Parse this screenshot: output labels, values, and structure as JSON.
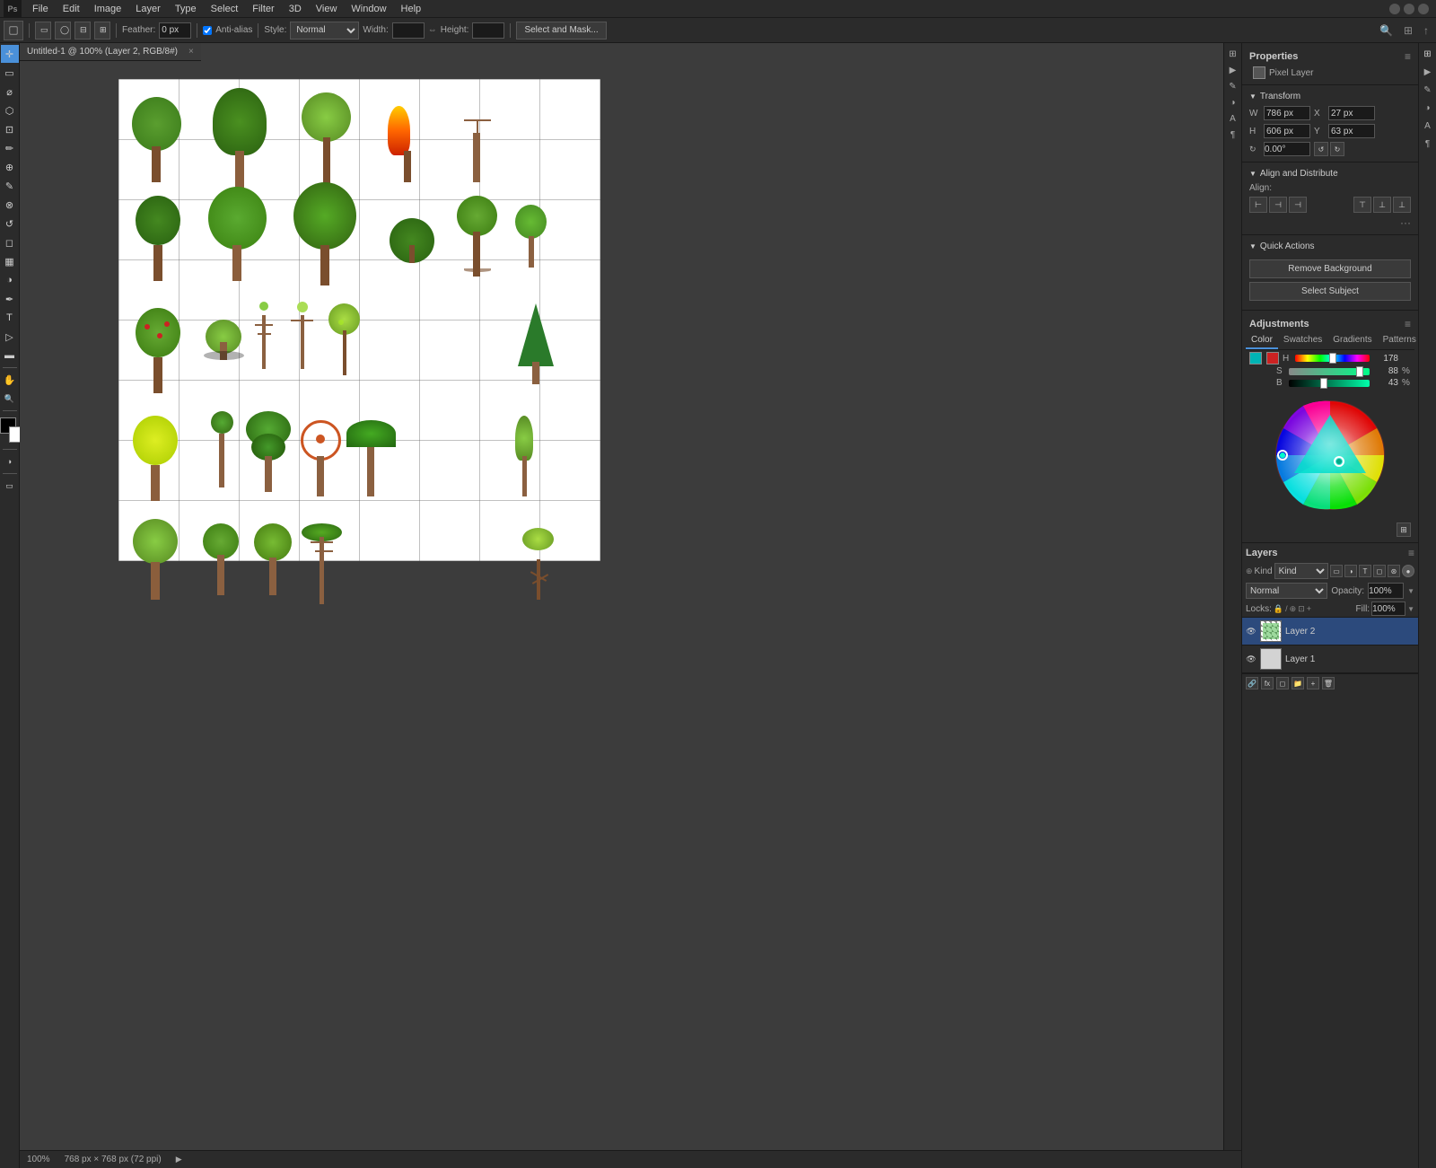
{
  "menubar": {
    "app_icon": "PS",
    "items": [
      "File",
      "Edit",
      "Image",
      "Layer",
      "Type",
      "Select",
      "Filter",
      "3D",
      "View",
      "Window",
      "Help"
    ]
  },
  "toolbar": {
    "feather_label": "Feather:",
    "feather_value": "0 px",
    "anti_alias_label": "Anti-alias",
    "style_label": "Style:",
    "style_value": "Normal",
    "width_label": "Width:",
    "width_value": "",
    "height_label": "Height:",
    "height_value": "",
    "select_mask_btn": "Select and Mask..."
  },
  "canvas_tab": {
    "title": "Untitled-1 @ 100% (Layer 2, RGB/8#)",
    "close": "×"
  },
  "left_tools": [
    {
      "name": "move-tool",
      "icon": "✛",
      "active": true
    },
    {
      "name": "marquee-tool",
      "icon": "▭"
    },
    {
      "name": "lasso-tool",
      "icon": "⌀"
    },
    {
      "name": "quick-select-tool",
      "icon": "⬡"
    },
    {
      "name": "crop-tool",
      "icon": "⊡"
    },
    {
      "name": "eyedropper-tool",
      "icon": "✏"
    },
    {
      "name": "healing-tool",
      "icon": "⊕"
    },
    {
      "name": "brush-tool",
      "icon": "✎"
    },
    {
      "name": "clone-tool",
      "icon": "⊗"
    },
    {
      "name": "history-tool",
      "icon": "↺"
    },
    {
      "name": "eraser-tool",
      "icon": "◻"
    },
    {
      "name": "gradient-tool",
      "icon": "▦"
    },
    {
      "name": "dodge-tool",
      "icon": "◑"
    },
    {
      "name": "pen-tool",
      "icon": "✒"
    },
    {
      "name": "text-tool",
      "icon": "T"
    },
    {
      "name": "path-select-tool",
      "icon": "▷"
    },
    {
      "name": "shape-tool",
      "icon": "▬"
    },
    {
      "name": "hand-tool",
      "icon": "✋"
    },
    {
      "name": "zoom-tool",
      "icon": "🔍"
    }
  ],
  "properties_panel": {
    "title": "Properties",
    "pixel_layer_label": "Pixel Layer",
    "transform_section": "Transform",
    "w_label": "W",
    "w_value": "786 px",
    "x_label": "X",
    "x_value": "27 px",
    "h_label": "H",
    "h_value": "606 px",
    "y_label": "Y",
    "y_value": "63 px",
    "rotate_value": "0.00°",
    "align_distribute_section": "Align and Distribute",
    "align_label": "Align:"
  },
  "quick_actions": {
    "title": "Quick Actions",
    "remove_bg_btn": "Remove Background",
    "select_subject_btn": "Select Subject"
  },
  "adjustments_panel": {
    "title": "Adjustments",
    "tabs": [
      "Color",
      "Swatches",
      "Gradients",
      "Patterns"
    ],
    "active_tab": "Color",
    "h_label": "H",
    "h_value": "178",
    "s_label": "S",
    "s_value": "88",
    "s_pct": "%",
    "b_label": "B",
    "b_value": "43",
    "b_pct": "%"
  },
  "layers_panel": {
    "title": "Layers",
    "kind_label": "Kind",
    "blend_mode": "Normal",
    "opacity_label": "Opacity:",
    "opacity_value": "100%",
    "fill_label": "Fill:",
    "fill_value": "100%",
    "layers": [
      {
        "name": "Layer 2",
        "visible": true,
        "selected": true
      },
      {
        "name": "Layer 1",
        "visible": true,
        "selected": false
      }
    ]
  },
  "status_bar": {
    "zoom": "100%",
    "dimensions": "768 px × 768 px (72 ppi)"
  },
  "colors": {
    "accent_blue": "#4a90d9",
    "bg_dark": "#2b2b2b",
    "bg_medium": "#3c3c3c",
    "panel_bg": "#2b2b2b",
    "canvas_bg": "#3c3c3c",
    "cyan_swatch": "#00b4b4",
    "red_swatch": "#cc2222"
  }
}
